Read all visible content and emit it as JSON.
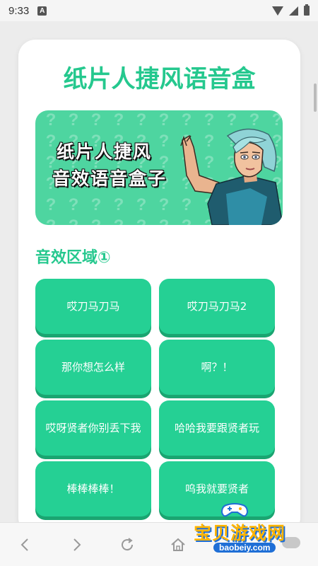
{
  "status_bar": {
    "time": "9:33",
    "notification_icon": "A"
  },
  "page": {
    "title": "纸片人捷风语音盒"
  },
  "banner": {
    "line1": "纸片人捷风",
    "line2": "音效语音盒子",
    "pattern_glyph": "?"
  },
  "section": {
    "title": "音效区域①"
  },
  "buttons": [
    {
      "label": "哎刀马刀马"
    },
    {
      "label": "哎刀马刀马2"
    },
    {
      "label": "那你想怎么样"
    },
    {
      "label": "啊？！"
    },
    {
      "label": "哎呀贤者你别丢下我"
    },
    {
      "label": "哈哈我要跟贤者玩"
    },
    {
      "label": "棒棒棒棒！"
    },
    {
      "label": "呜我就要贤者"
    }
  ],
  "bottom_nav": [
    "back-icon",
    "forward-icon",
    "refresh-icon",
    "home-icon"
  ],
  "watermark": {
    "brand": "宝贝游戏网",
    "url": "baobeiy.com"
  },
  "colors": {
    "accent": "#25c88e",
    "button": "#25d094",
    "button_shadow": "#1aa571"
  }
}
